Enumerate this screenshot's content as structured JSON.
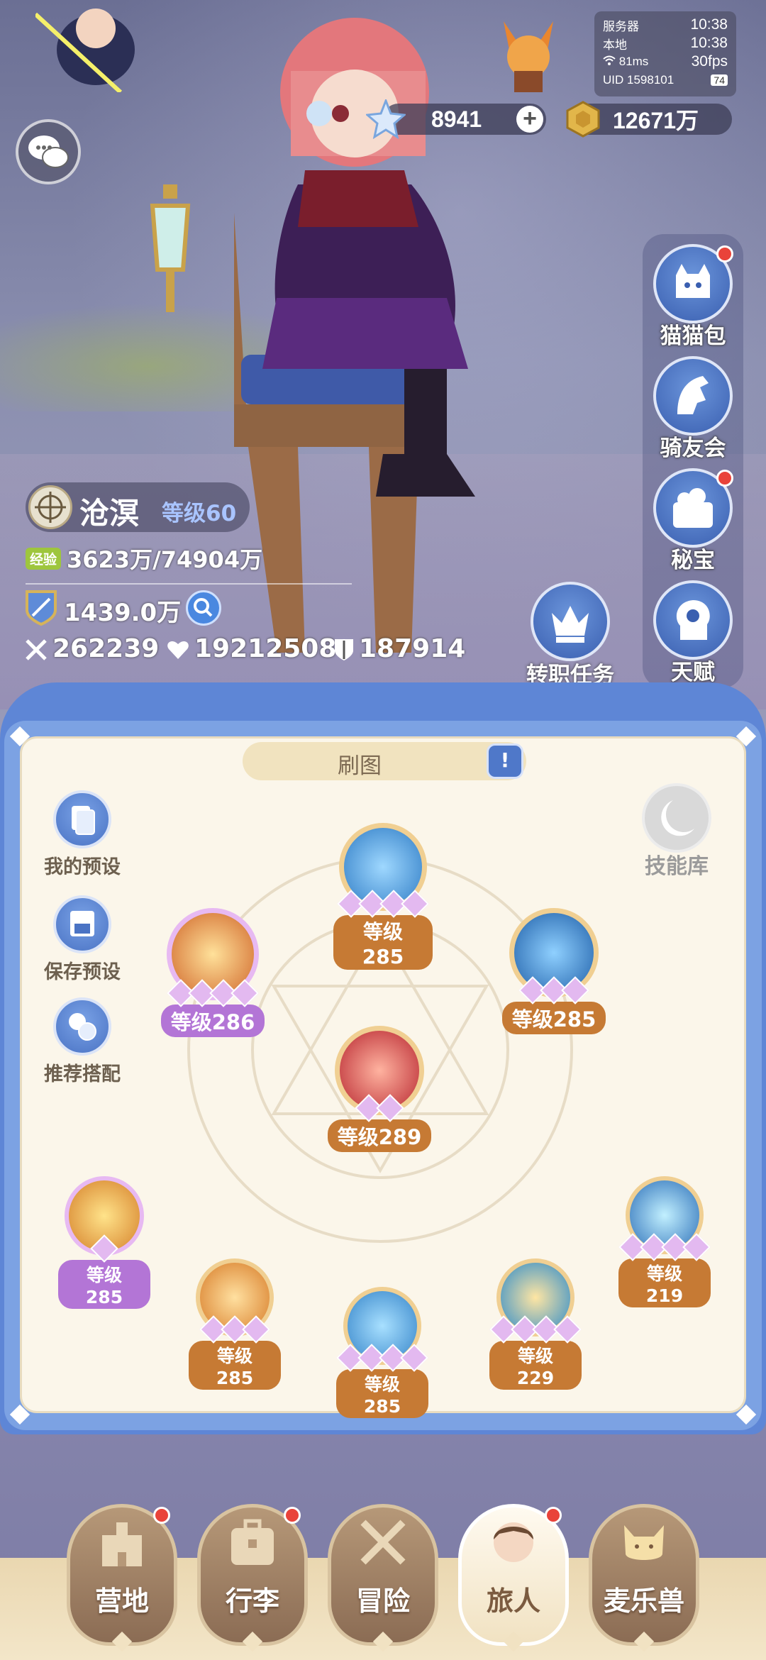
{
  "status": {
    "server_label": "服务器",
    "server_time": "10:38",
    "local_label": "本地",
    "local_time": "10:38",
    "ping": "81ms",
    "fps": "30fps",
    "uid": "UID 1598101",
    "battery": "74"
  },
  "currency": {
    "gems": "8941",
    "gold": "12671万"
  },
  "side_menu": [
    {
      "label": "猫猫包",
      "badge": true
    },
    {
      "label": "骑友会",
      "badge": false
    },
    {
      "label": "秘宝",
      "badge": true
    },
    {
      "label": "天赋",
      "badge": false
    }
  ],
  "quest": {
    "label": "转职任务"
  },
  "player": {
    "name": "沧溟",
    "level": "等级60",
    "exp_tag": "经验",
    "exp": "3623万/74904万",
    "power": "1439.0万",
    "attack": "262239",
    "hp": "19212508",
    "defense": "187914"
  },
  "panel": {
    "tab_label": "刷图",
    "skill_library": "技能库",
    "options": [
      "我的预设",
      "保存预设",
      "推荐搭配"
    ]
  },
  "skills": [
    {
      "level": "等级285",
      "stars": 4,
      "tag": "orange",
      "color": "#2f7cc5"
    },
    {
      "level": "等级286",
      "stars": 4,
      "tag": "purple",
      "color": "#d0662a"
    },
    {
      "level": "等级285",
      "stars": 3,
      "tag": "orange",
      "color": "#1f5fa8"
    },
    {
      "level": "等级289",
      "stars": 2,
      "tag": "orange",
      "color": "#b8262f"
    },
    {
      "level": "等级285",
      "stars": 1,
      "tag": "purple",
      "color": "#d5802a"
    },
    {
      "level": "等级285",
      "stars": 3,
      "tag": "orange",
      "color": "#d77b27"
    },
    {
      "level": "等级285",
      "stars": 4,
      "tag": "orange",
      "color": "#3584c9"
    },
    {
      "level": "等级229",
      "stars": 4,
      "tag": "orange",
      "color": "#2b8acb"
    },
    {
      "level": "等级219",
      "stars": 4,
      "tag": "orange",
      "color": "#2c6fb8"
    }
  ],
  "nav": [
    {
      "label": "营地",
      "badge": true,
      "active": false
    },
    {
      "label": "行李",
      "badge": true,
      "active": false
    },
    {
      "label": "冒险",
      "badge": false,
      "active": false
    },
    {
      "label": "旅人",
      "badge": true,
      "active": true
    },
    {
      "label": "麦乐兽",
      "badge": false,
      "active": false
    }
  ]
}
